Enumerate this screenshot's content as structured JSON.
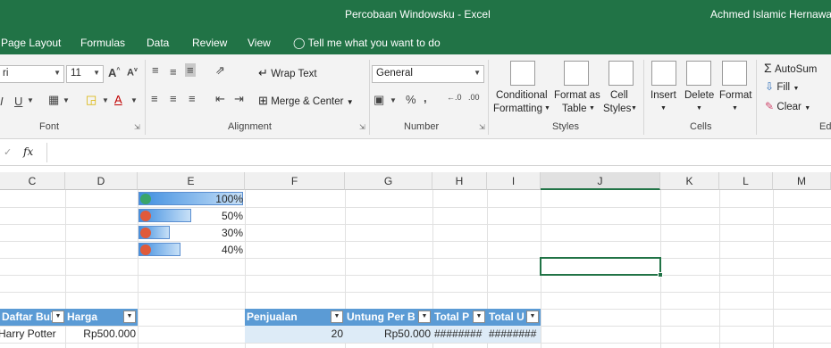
{
  "window": {
    "title": "Percobaan Windowsku  -  Excel",
    "user": "Achmed Islamic Hernawan"
  },
  "tabs": [
    "Page Layout",
    "Formulas",
    "Data",
    "Review",
    "View"
  ],
  "tell_me": "Tell me what you want to do",
  "ribbon": {
    "font": {
      "name": "ri",
      "size": "11",
      "group_label": "Font"
    },
    "alignment": {
      "wrap_text": "Wrap Text",
      "merge_center": "Merge & Center",
      "group_label": "Alignment"
    },
    "number": {
      "format": "General",
      "group_label": "Number"
    },
    "styles": {
      "conditional_1": "Conditional",
      "conditional_2": "Formatting",
      "format_table_1": "Format as",
      "format_table_2": "Table",
      "cell_styles_1": "Cell",
      "cell_styles_2": "Styles",
      "group_label": "Styles"
    },
    "cells": {
      "insert": "Insert",
      "delete": "Delete",
      "format": "Format",
      "group_label": "Cells"
    },
    "editing": {
      "autosum": "AutoSum",
      "fill": "Fill",
      "clear": "Clear",
      "group_label": "Ed"
    }
  },
  "formula_bar": {
    "fx": "fx",
    "value": ""
  },
  "columns": [
    "C",
    "D",
    "E",
    "F",
    "G",
    "H",
    "I",
    "J",
    "K",
    "L",
    "M"
  ],
  "databars": [
    {
      "label": "100%",
      "fraction": 1.0,
      "direction": "up"
    },
    {
      "label": "50%",
      "fraction": 0.5,
      "direction": "down"
    },
    {
      "label": "30%",
      "fraction": 0.3,
      "direction": "down"
    },
    {
      "label": "40%",
      "fraction": 0.4,
      "direction": "down"
    }
  ],
  "table1": {
    "headers": [
      "Daftar Buk",
      "Harga"
    ],
    "row": [
      "Harry Potter",
      "Rp500.000"
    ]
  },
  "table2": {
    "headers": [
      "Penjualan",
      "Untung Per B",
      "Total P",
      "Total U"
    ],
    "row": [
      "20",
      "Rp50.000",
      "########",
      "########"
    ]
  },
  "colors": {
    "excel_green": "#217346",
    "table_header": "#5b9bd5"
  }
}
